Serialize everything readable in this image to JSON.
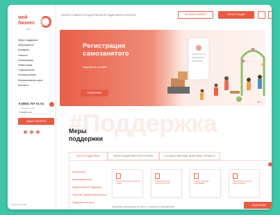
{
  "logo": {
    "line1": "мой",
    "line2": "бизнес",
    "line3": "ufa"
  },
  "sidebar": {
    "items": [
      "Меры поддержки",
      "Мероприятия",
      "Конкурсы",
      "Новости",
      "Организации",
      "Инвесторам",
      "Самозанятым",
      "История успеха",
      "Интерактивная карта",
      "Контакты"
    ],
    "phone": "8 (800) 707 01 01",
    "phone_sub": "горячая линия",
    "chat_link": "Онлайн-чат",
    "button": "ЗАДАТЬ ВОПРОС",
    "copyright": "© Мой бизнес 2021"
  },
  "topbar": {
    "text": "УЗНАЙТЕ О МЕРАХ ГОСУДАРСТВЕННОЙ ПОДДЕРЖКИ И ПРОЕКТАХ",
    "btn_outline": "ЛИЧНЫЙ КАБИНЕТ",
    "btn_filled": "РЕГИСТРАЦИЯ"
  },
  "banner": {
    "title_line1": "Регистрация",
    "title_line2": "самозанятого",
    "subtitle": "Подробности на сайте",
    "button": "ПОДРОБНЕЕ"
  },
  "support": {
    "watermark": "#Поддержка",
    "title_line1": "Меры",
    "title_line2": "поддержки",
    "tabs": [
      "МЕРЫ ПОДДЕРЖКИ",
      "МЕРЫ ПОДДЕРЖКИ РЕСПУБЛИКИ",
      "ГОСУДАРСТВЕННЫЕ ЦИФРОВЫЕ СЕРВИСЫ"
    ],
    "left_menu": [
      "Финансовая",
      "Консультационная",
      "Имущественная поддержка",
      "Обучение предпринимательству",
      "Поддержка экспорта"
    ],
    "cards": [
      "Предоставление льготного займа",
      "Предоставление поручительства",
      "Предоставление микрозайма",
      "Программа льготного кредитования"
    ],
    "note": "Подробная информация на сайте по каждому из направлений",
    "button": "ПОДРОБНЕЕ"
  }
}
